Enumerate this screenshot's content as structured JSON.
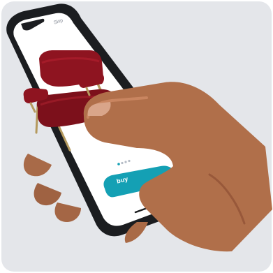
{
  "scene": {
    "background_color": "#e4e6ea",
    "phone_color": "#1b1d20",
    "accent_color": "#14a0b4",
    "chair_color": "#8e1420",
    "icons": [
      "hand",
      "phone",
      "chair",
      "pager-dots"
    ]
  },
  "screen": {
    "skip_label": "Skip",
    "buy_label": "buy"
  },
  "pager": {
    "active_index": 0,
    "count": 4
  }
}
